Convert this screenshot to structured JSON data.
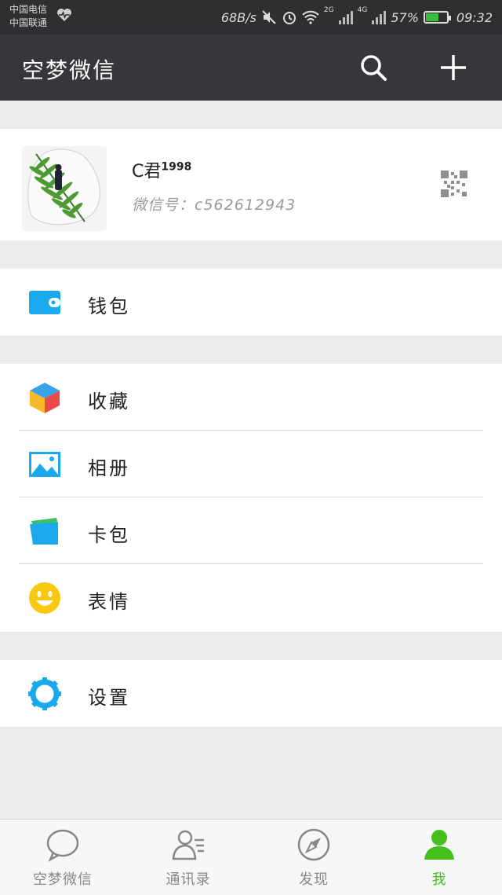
{
  "status_bar": {
    "carrier_1": "中国电信",
    "carrier_2": "中国联通",
    "net_speed": "68B/s",
    "net_2g": "2G",
    "net_4g": "4G",
    "battery": "57%",
    "time": "09:32",
    "battery_level": 0.57
  },
  "header": {
    "title": "空梦微信",
    "search_icon": "search-icon",
    "add_icon": "plus-icon"
  },
  "profile": {
    "nickname": "C君",
    "nickname_suffix": "1998",
    "wechat_id": "微信号：c562612943"
  },
  "menu": {
    "wallet": "钱包",
    "favorites": "收藏",
    "album": "相册",
    "cards": "卡包",
    "stickers": "表情",
    "settings": "设置"
  },
  "tabs": [
    {
      "label": "空梦微信",
      "icon": "chat-icon",
      "active": false
    },
    {
      "label": "通讯录",
      "icon": "contacts-icon",
      "active": false
    },
    {
      "label": "发现",
      "icon": "compass-icon",
      "active": false
    },
    {
      "label": "我",
      "icon": "person-icon",
      "active": true
    }
  ],
  "colors": {
    "accent": "#45c01a",
    "header_bg": "#37373b",
    "status_bg": "#2f2f31"
  }
}
